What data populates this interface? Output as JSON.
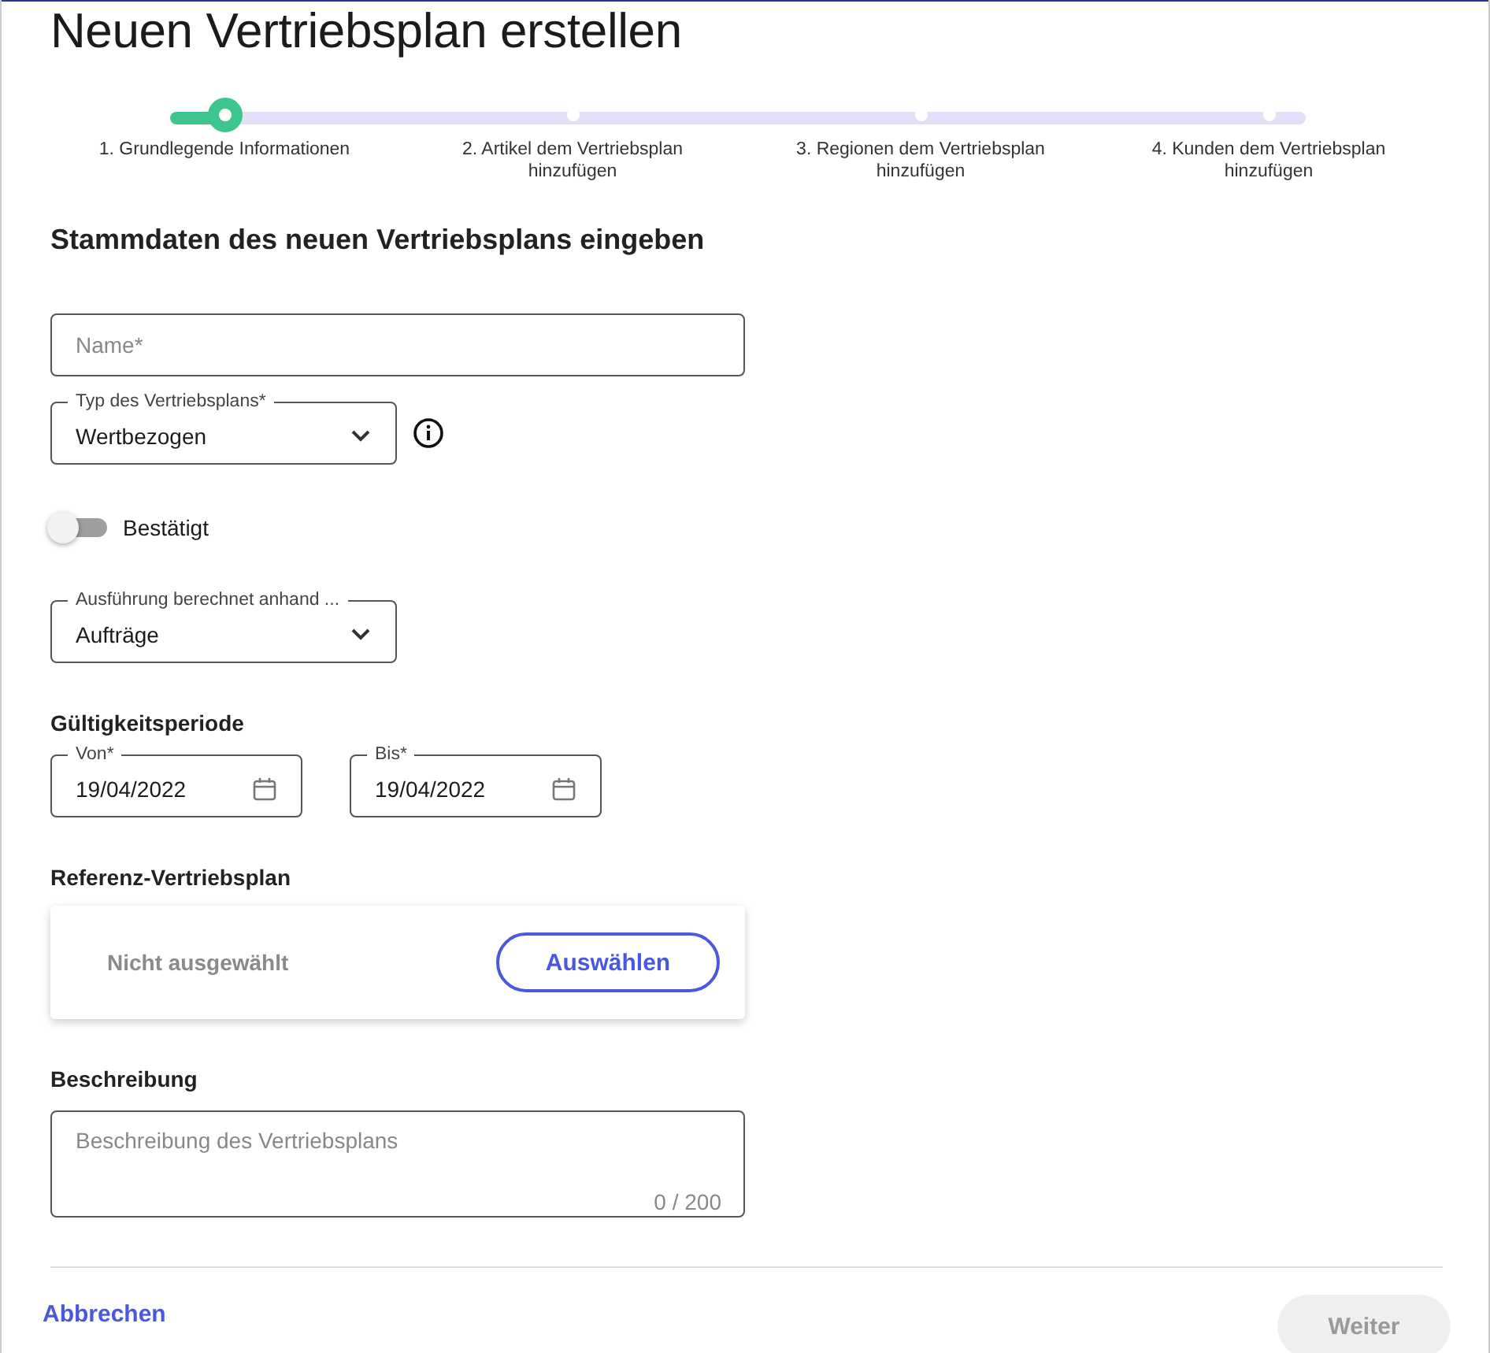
{
  "title": "Neuen Vertriebsplan erstellen",
  "steps": [
    {
      "label": "1. Grundlegende Informationen",
      "selected": true
    },
    {
      "label": "2. Artikel dem Vertriebsplan hinzufügen",
      "selected": false
    },
    {
      "label": "3. Regionen dem Vertriebsplan hinzufügen",
      "selected": false
    },
    {
      "label": "4. Kunden dem Vertriebsplan hinzufügen",
      "selected": false
    }
  ],
  "section_title": "Stammdaten des neuen Vertriebsplans eingeben",
  "name_field": {
    "placeholder": "Name*"
  },
  "type_select": {
    "label": "Typ des Vertriebsplans*",
    "value": "Wertbezogen"
  },
  "confirmed_toggle": {
    "label": "Bestätigt",
    "on": false
  },
  "execution_select": {
    "label": "Ausführung berechnet anhand ...",
    "value": "Aufträge"
  },
  "validity": {
    "heading": "Gültigkeitsperiode",
    "from": {
      "label": "Von*",
      "value": "19/04/2022"
    },
    "to": {
      "label": "Bis*",
      "value": "19/04/2022"
    }
  },
  "reference": {
    "heading": "Referenz-Vertriebsplan",
    "status": "Nicht ausgewählt",
    "button": "Auswählen"
  },
  "description": {
    "heading": "Beschreibung",
    "placeholder": "Beschreibung des Vertriebsplans",
    "counter": "0 / 200"
  },
  "footer": {
    "cancel": "Abbrechen",
    "next": {
      "label": "Weiter",
      "disabled": true
    }
  }
}
